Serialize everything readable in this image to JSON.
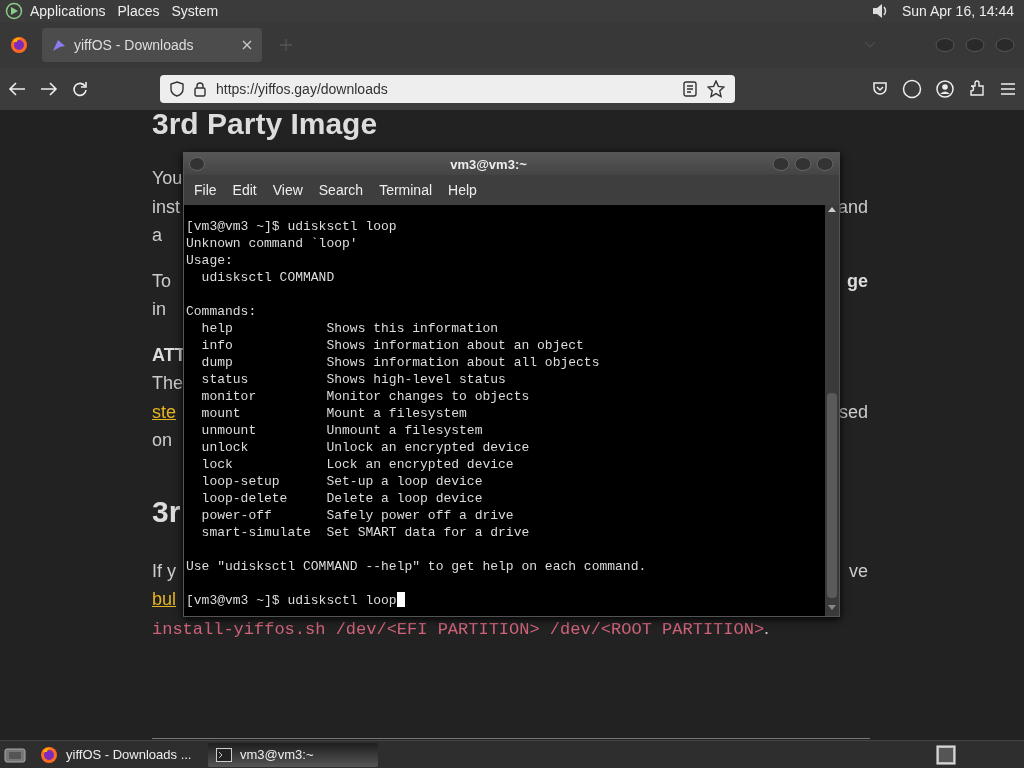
{
  "top_panel": {
    "menus": [
      "Applications",
      "Places",
      "System"
    ],
    "clock": "Sun Apr 16, 14:44"
  },
  "browser": {
    "tabs": [
      {
        "title": "yiffOS - Downloads",
        "selected": true
      }
    ],
    "url": "https://yiffos.gay/downloads"
  },
  "page": {
    "blocks": [
      {
        "kind": "heading",
        "lines": [
          {
            "left": [
              {
                "text": "3rd Party Image",
                "kind": "plain"
              }
            ]
          }
        ]
      },
      {
        "kind": "paragraph",
        "lines": [
          {
            "left": [
              {
                "text": "You",
                "kind": "plain"
              }
            ]
          },
          {
            "left": [
              {
                "text": "inst",
                "kind": "plain"
              }
            ],
            "right": [
              {
                "text": "and",
                "kind": "plain"
              }
            ]
          },
          {
            "left": [
              {
                "text": "a",
                "kind": "plain"
              }
            ]
          }
        ]
      },
      {
        "kind": "paragraph",
        "lines": [
          {
            "left": [
              {
                "text": "To",
                "kind": "plain"
              }
            ],
            "right": [
              {
                "text": "ge",
                "kind": "bold"
              }
            ]
          },
          {
            "left": [
              {
                "text": "in",
                "kind": "plain"
              }
            ]
          }
        ]
      },
      {
        "kind": "paragraph",
        "lines": [
          {
            "left": [
              {
                "text": "ATT",
                "kind": "bold"
              }
            ]
          },
          {
            "left": [
              {
                "text": "The",
                "kind": "plain"
              }
            ]
          },
          {
            "left": [
              {
                "text": "ste",
                "kind": "link"
              }
            ],
            "right": [
              {
                "text": "sed",
                "kind": "plain"
              }
            ]
          },
          {
            "left": [
              {
                "text": "on",
                "kind": "plain"
              }
            ]
          }
        ]
      },
      {
        "kind": "heading",
        "lines": [
          {
            "left": [
              {
                "text": "3r",
                "kind": "plain"
              }
            ]
          }
        ]
      },
      {
        "kind": "paragraph",
        "lines": [
          {
            "left": [
              {
                "text": "If y",
                "kind": "plain"
              }
            ],
            "right": [
              {
                "text": "ve",
                "kind": "plain"
              }
            ]
          },
          {
            "left": [
              {
                "text": "bul",
                "kind": "link"
              }
            ]
          },
          {
            "left": [
              {
                "text": "install-yiffos.sh /dev/<EFI PARTITION> /dev/<ROOT PARTITION>",
                "kind": "code"
              },
              {
                "text": ".",
                "kind": "plain"
              }
            ]
          }
        ]
      }
    ]
  },
  "terminal": {
    "title": "vm3@vm3:~",
    "menu": [
      "File",
      "Edit",
      "View",
      "Search",
      "Terminal",
      "Help"
    ],
    "groups": [
      [
        "[vm3@vm3 ~]$ udisksctl loop",
        "Unknown command `loop'",
        "Usage:",
        "  udisksctl COMMAND"
      ],
      [
        "Commands:",
        "  help            Shows this information",
        "  info            Shows information about an object",
        "  dump            Shows information about all objects",
        "  status          Shows high-level status",
        "  monitor         Monitor changes to objects",
        "  mount           Mount a filesystem",
        "  unmount         Unmount a filesystem",
        "  unlock          Unlock an encrypted device",
        "  lock            Lock an encrypted device",
        "  loop-setup      Set-up a loop device",
        "  loop-delete     Delete a loop device",
        "  power-off       Safely power off a drive",
        "  smart-simulate  Set SMART data for a drive"
      ],
      [
        "Use \"udisksctl COMMAND --help\" to get help on each command."
      ],
      [
        "[vm3@vm3 ~]$ udisksctl loop"
      ]
    ]
  },
  "taskbar": {
    "items": [
      {
        "kind": "browser",
        "label": "yiffOS - Downloads ...",
        "selected": false
      },
      {
        "kind": "terminal",
        "label": "vm3@vm3:~",
        "selected": true
      }
    ]
  }
}
